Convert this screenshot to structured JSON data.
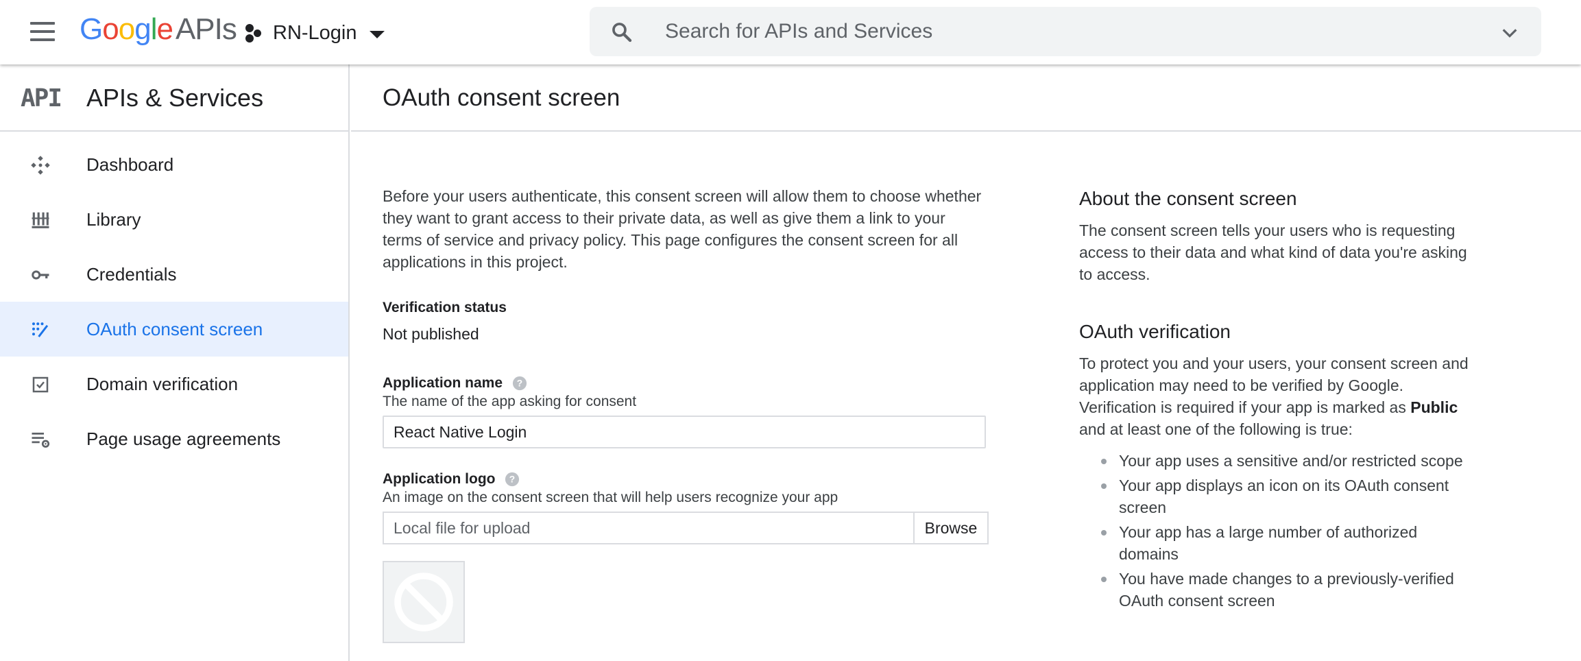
{
  "topbar": {
    "logo_google": [
      "G",
      "o",
      "o",
      "g",
      "l",
      "e"
    ],
    "logo_suffix": "APIs",
    "project_name": "RN-Login",
    "search_placeholder": "Search for APIs and Services"
  },
  "sidebar": {
    "mark": "API",
    "title": "APIs & Services",
    "items": [
      {
        "label": "Dashboard",
        "icon": "dashboard-icon"
      },
      {
        "label": "Library",
        "icon": "library-icon"
      },
      {
        "label": "Credentials",
        "icon": "key-icon"
      },
      {
        "label": "OAuth consent screen",
        "icon": "consent-icon",
        "active": true
      },
      {
        "label": "Domain verification",
        "icon": "checkbox-icon"
      },
      {
        "label": "Page usage agreements",
        "icon": "settings-list-icon"
      }
    ]
  },
  "main": {
    "title": "OAuth consent screen",
    "intro": "Before your users authenticate, this consent screen will allow them to choose whether they want to grant access to their private data, as well as give them a link to your terms of service and privacy policy. This page configures the consent screen for all applications in this project.",
    "verification_status_label": "Verification status",
    "verification_status_value": "Not published",
    "app_name_label": "Application name",
    "app_name_desc": "The name of the app asking for consent",
    "app_name_value": "React Native Login",
    "app_logo_label": "Application logo",
    "app_logo_desc": "An image on the consent screen that will help users recognize your app",
    "app_logo_placeholder": "Local file for upload",
    "browse_label": "Browse"
  },
  "aside": {
    "about_title": "About the consent screen",
    "about_text": "The consent screen tells your users who is requesting access to their data and what kind of data you're asking to access.",
    "verification_title": "OAuth verification",
    "verification_text_1": "To protect you and your users, your consent screen and application may need to be verified by Google. Verification is required if your app is marked as",
    "verification_bold": "Public",
    "verification_text_2": "and at least one of the following is true:",
    "bullets": [
      "Your app uses a sensitive and/or restricted scope",
      "Your app displays an icon on its OAuth consent screen",
      "Your app has a large number of authorized domains",
      "You have made changes to a previously-verified OAuth consent screen"
    ]
  },
  "colors": {
    "accent": "#1a73e8",
    "active_bg": "#e8f0fe",
    "icon_gray": "#5f6368",
    "border": "#dadce0"
  }
}
